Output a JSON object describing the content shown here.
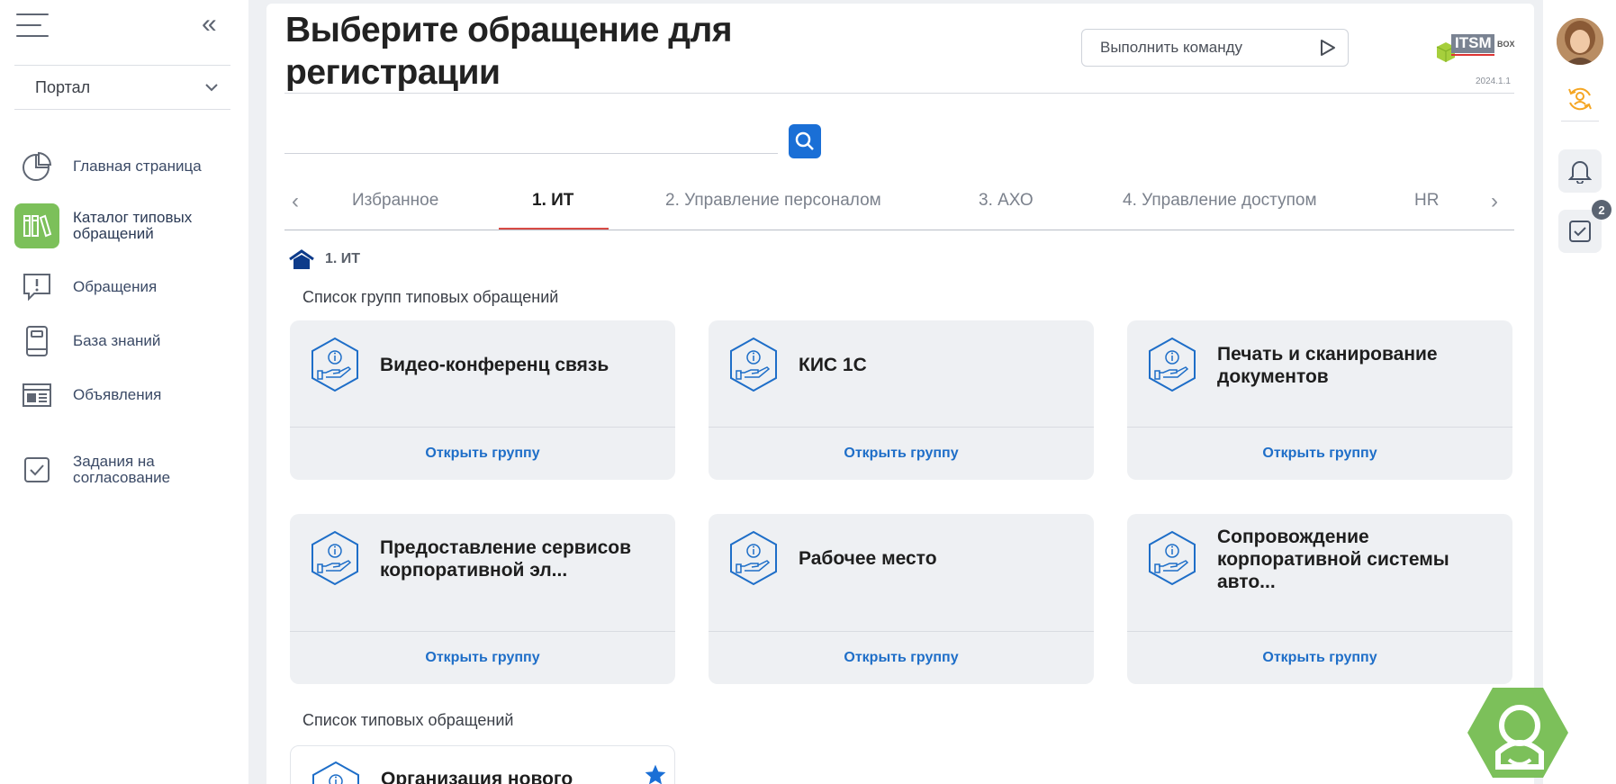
{
  "sidebar": {
    "portal_select": "Портал",
    "items": [
      {
        "label": "Главная страница",
        "icon": "pie-chart-icon"
      },
      {
        "label": "Каталог типовых обращений",
        "icon": "books-icon",
        "active": true
      },
      {
        "label": "Обращения",
        "icon": "message-alert-icon"
      },
      {
        "label": "База знаний",
        "icon": "book-icon"
      },
      {
        "label": "Объявления",
        "icon": "newspaper-icon"
      },
      {
        "label": "Задания на согласование",
        "icon": "checkbox-icon"
      }
    ]
  },
  "header": {
    "title": "Выберите обращение для регистрации",
    "command_placeholder": "Выполнить команду",
    "logo_text": "ITSM",
    "logo_suffix": "BOX",
    "version": "2024.1.1"
  },
  "search": {
    "value": ""
  },
  "tabs": [
    "Избранное",
    "1. ИТ",
    "2. Управление персоналом",
    "3. АХО",
    "4. Управление доступом",
    "HR"
  ],
  "active_tab": "1. ИТ",
  "breadcrumb": "1. ИТ",
  "groups_heading": "Список групп типовых обращений",
  "groups": [
    {
      "title": "Видео-конференц связь",
      "link": "Открыть группу"
    },
    {
      "title": "КИС 1С",
      "link": "Открыть группу"
    },
    {
      "title": "Печать и сканирование документов",
      "link": "Открыть группу"
    },
    {
      "title": "Предоставление сервисов корпоративной эл...",
      "link": "Открыть группу"
    },
    {
      "title": "Рабочее место",
      "link": "Открыть группу"
    },
    {
      "title": "Сопровождение корпоративной системы авто...",
      "link": "Открыть группу"
    }
  ],
  "requests_heading": "Список типовых обращений",
  "requests": [
    {
      "title": "Организация нового",
      "favorite": true
    }
  ],
  "rightbar": {
    "tasks_badge": "2"
  },
  "colors": {
    "accent": "#1a6fd6",
    "green": "#7cc05a",
    "active_tab_underline": "#d84b45",
    "orange": "#f5a623"
  }
}
